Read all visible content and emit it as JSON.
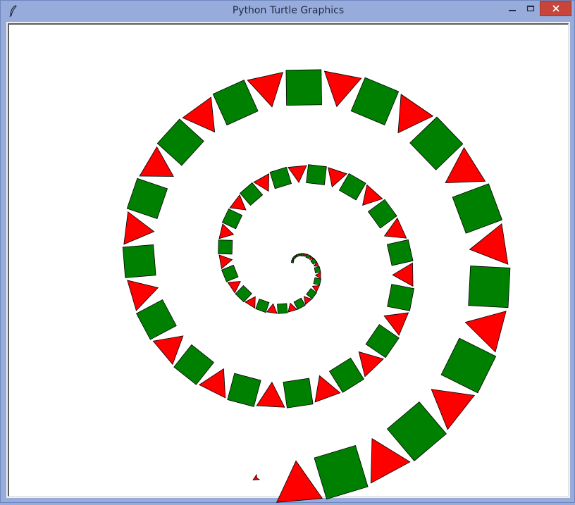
{
  "window": {
    "title": "Python Turtle Graphics",
    "app_icon": "feather-icon"
  },
  "controls": {
    "minimize_icon": "minimize-icon",
    "maximize_icon": "maximize-icon",
    "close_icon": "close-icon"
  },
  "colors": {
    "square_fill": "#008000",
    "triangle_fill": "#ff0000",
    "outline": "#000000",
    "canvas_bg": "#ffffff",
    "frame": "#98acdc",
    "close_button": "#c7453b"
  },
  "drawing": {
    "shapes": "alternating green squares and red triangles along an outward spiral",
    "pen_icon": "turtle-arrow-icon"
  }
}
